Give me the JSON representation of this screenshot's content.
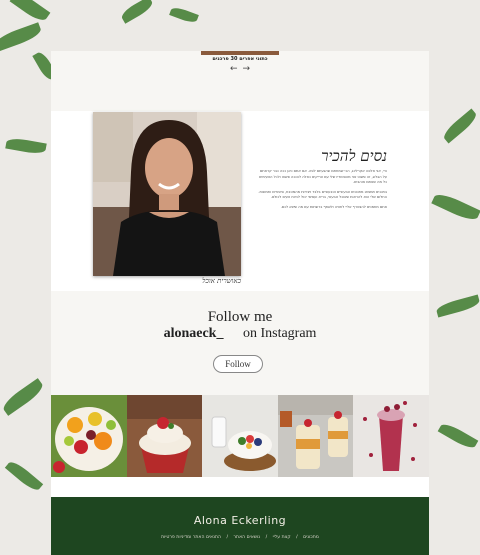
{
  "top_section": {
    "label": "כתוני אפרים 30 פרכנים",
    "prev_arrow": "←",
    "next_arrow": "→"
  },
  "about": {
    "title": "נסים להכיר",
    "paragraphs": [
      "היי, אני אלונה אקרלינג, הכי שמחתם שהגעתם לפה. אם אתם כאן ככה כבר קראתם על הבלוג, זה פשוט אני מהסטודיו שלי עם טריקים כאלה להכנה פשוט ולכל הטעימים כל מה שאתם אוהבים.",
      "בתכנים תמצאו מתכונים טבעוניים וטבעוניים בלבד ויצירות מהמטבח, סיפורים ותמונות. החלום שלי הוא להראות שאוכל טבעוני, בריא ועסיסי יכול להיות טעים לכולם.",
      "אתם מוזמנים להצטרף אליי לחוויה ולשתף ברשתות עם מה שיצא לכם."
    ],
    "photo_caption": "כאושרית אוכל"
  },
  "instagram": {
    "line1": "Follow me",
    "handle": "alonaeck_",
    "line2_suffix": "on Instagram",
    "button": "Follow"
  },
  "gallery": {
    "tiles": [
      "fruit-salad",
      "cupcake",
      "smoothie-bowl",
      "parfait-jars",
      "berry-shake"
    ]
  },
  "footer": {
    "brand": "Alona Eckerling",
    "nav": [
      "מתכונים",
      "קצת עליי",
      "נושאים האתר",
      "התנאים האתר ומדיניות פרטיות"
    ]
  },
  "colors": {
    "footer_bg": "#1e4620",
    "page_bg": "#ffffff",
    "soft_bg": "#f7f6f3"
  }
}
